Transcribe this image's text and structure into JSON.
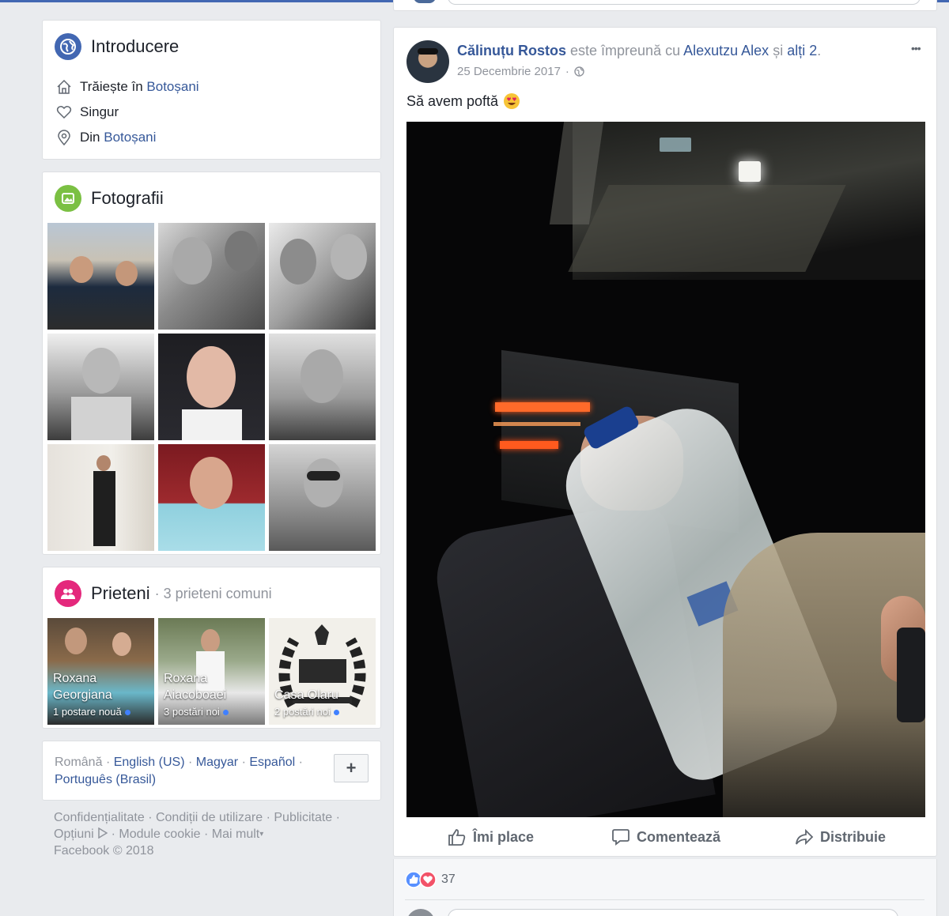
{
  "intro": {
    "title": "Introducere",
    "lives_prefix": "Trăiește în ",
    "lives_city": "Botoșani",
    "relationship": "Singur",
    "from_prefix": "Din ",
    "from_city": "Botoșani"
  },
  "photos": {
    "title": "Fotografii"
  },
  "friends": {
    "title": "Prieteni",
    "mutual": "· 3 prieteni comuni",
    "items": [
      {
        "name1": "Roxana",
        "name2": "Georgiana",
        "sub": "1 postare nouă"
      },
      {
        "name1": "Roxana",
        "name2": "Aiacoboaei",
        "sub": "3 postări noi"
      },
      {
        "name1": "",
        "name2": "Casa Olaru",
        "sub": "2 postări noi"
      }
    ]
  },
  "languages": {
    "current": "Română",
    "l1": "English (US)",
    "l2": "Magyar",
    "l3": "Español",
    "l4": "Português (Brasil)",
    "add": "+"
  },
  "footer": {
    "privacy": "Confidențialitate",
    "terms": "Condiții de utilizare",
    "ads": "Publicitate",
    "options": "Opțiuni",
    "cookies": "Module cookie",
    "more": "Mai mult",
    "copyright": "Facebook © 2018"
  },
  "post": {
    "author": "Călinuțu Rostos",
    "with_text": "este împreună cu",
    "tagged": "Alexutzu Alex",
    "and": "și",
    "others": "alți 2",
    "date": "25 Decembrie 2017",
    "text": "Să avem poftă",
    "more": "•••"
  },
  "actions": {
    "like": "Îmi place",
    "comment": "Comentează",
    "share": "Distribuie"
  },
  "reactions": {
    "count": "37"
  },
  "colors": {
    "brand": "#4267b2",
    "link": "#365899",
    "background": "#e9ebee"
  }
}
